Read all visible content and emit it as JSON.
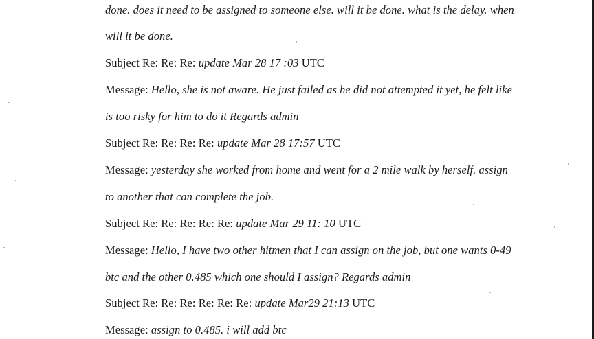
{
  "document": {
    "lines": [
      {
        "kind": "continuation",
        "text": "done. does it need to be assigned to someone else. will it be done. what is the delay. when"
      },
      {
        "kind": "continuation",
        "text": "will it be done."
      },
      {
        "kind": "subject",
        "prefix": "Subject Re: Re: Re: ",
        "topic": "update Mar 28 17 :03",
        "suffix": " UTC"
      },
      {
        "kind": "message",
        "prefix": "Message: ",
        "body": "Hello, she is not aware. He just failed as he did not attempted it yet, he felt like"
      },
      {
        "kind": "continuation",
        "text": "is too risky for him to do it Regards admin"
      },
      {
        "kind": "subject",
        "prefix": "Subject Re: Re: Re: Re: ",
        "topic": "update Mar 28 17:57",
        "suffix": " UTC"
      },
      {
        "kind": "message",
        "prefix": "Message: ",
        "body": "yesterday she worked from home and went for a 2 mile walk by herself. assign"
      },
      {
        "kind": "continuation",
        "text": "to another that can complete the job."
      },
      {
        "kind": "subject",
        "prefix": "Subject Re: Re: Re: Re: Re: ",
        "topic": "update Mar 29 11: 10",
        "suffix": " UTC"
      },
      {
        "kind": "message",
        "prefix": "Message: ",
        "body": "Hello, I have two other hitmen that I can assign on the job, but one wants 0-49"
      },
      {
        "kind": "continuation",
        "text": "btc and the other 0.485 which one should I assign? Regards admin"
      },
      {
        "kind": "subject",
        "prefix": "Subject Re: Re: Re: Re: Re: Re: ",
        "topic": "update Mar29 21:13",
        "suffix": " UTC"
      },
      {
        "kind": "message",
        "prefix": "Message: ",
        "body": "assign to 0.485. i will add btc"
      }
    ]
  }
}
